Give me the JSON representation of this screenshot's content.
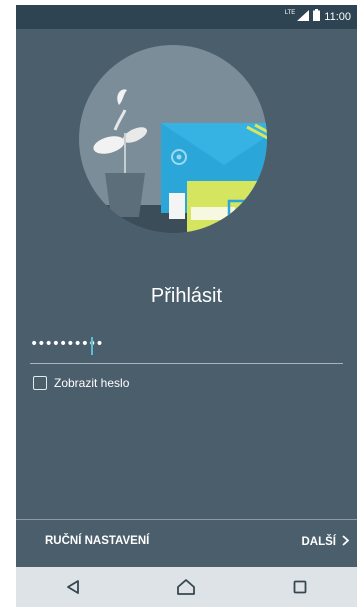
{
  "status_bar": {
    "network": "LTE",
    "time": "11:00"
  },
  "login": {
    "title": "Přihlásit",
    "password_value": "••••••••••",
    "show_password_label": "Zobrazit heslo"
  },
  "actions": {
    "manual_setup_label": "RUČNÍ NASTAVENÍ",
    "next_label": "DALŠÍ"
  },
  "colors": {
    "background": "#4a5e6c",
    "accent": "#56c1d4",
    "status_bar": "#2f4453",
    "nav_bar": "#dde3e6"
  },
  "icons": [
    "signal-icon",
    "battery-icon",
    "checkbox-icon",
    "chevron-right-icon",
    "back-icon",
    "home-icon",
    "recents-icon"
  ]
}
